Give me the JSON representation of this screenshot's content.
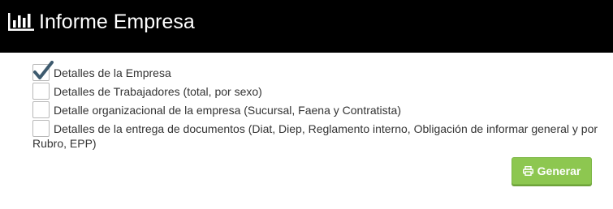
{
  "header": {
    "icon": "bar-chart-icon",
    "title": "Informe Empresa"
  },
  "options": [
    {
      "label": "Detalles de la Empresa",
      "checked": true
    },
    {
      "label": "Detalles de Trabajadores (total, por sexo)",
      "checked": false
    },
    {
      "label": "Detalle organizacional de la empresa (Sucursal, Faena y Contratista)",
      "checked": false
    },
    {
      "label": "Detalles de la entrega de documentos (Diat, Diep, Reglamento interno, Obligación de informar general y por Rubro, EPP)",
      "checked": false
    }
  ],
  "generate_button": {
    "icon": "print-icon",
    "label": "Generar"
  },
  "colors": {
    "header_bg": "#000000",
    "button_bg": "#8dc750",
    "check_color": "#3d5a6e"
  }
}
